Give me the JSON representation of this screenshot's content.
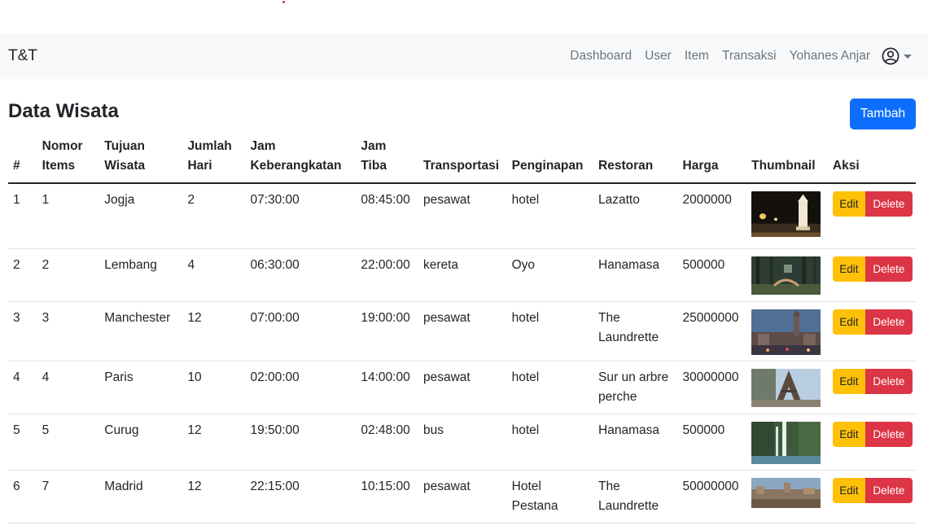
{
  "navbar": {
    "brand": "T&T",
    "links": [
      "Dashboard",
      "User",
      "Item",
      "Transaksi"
    ],
    "user_name": "Yohanes Anjar"
  },
  "page": {
    "title": "Data Wisata",
    "add_button": "Tambah"
  },
  "table": {
    "headers": [
      "#",
      "Nomor Items",
      "Tujuan Wisata",
      "Jumlah Hari",
      "Jam Keberangkatan",
      "Jam Tiba",
      "Transportasi",
      "Penginapan",
      "Restoran",
      "Harga",
      "Thumbnail",
      "Aksi"
    ],
    "edit_label": "Edit",
    "delete_label": "Delete",
    "rows": [
      {
        "no": "1",
        "nomor": "1",
        "tujuan": "Jogja",
        "hari": "2",
        "berangkat": "07:30:00",
        "tiba": "08:45:00",
        "transportasi": "pesawat",
        "penginapan": "hotel",
        "restoran": "Lazatto",
        "harga": "2000000",
        "thumb": "night-monument"
      },
      {
        "no": "2",
        "nomor": "2",
        "tujuan": "Lembang",
        "hari": "4",
        "berangkat": "06:30:00",
        "tiba": "22:00:00",
        "transportasi": "kereta",
        "penginapan": "Oyo",
        "restoran": "Hanamasa",
        "harga": "500000",
        "thumb": "forest-bridge"
      },
      {
        "no": "3",
        "nomor": "3",
        "tujuan": "Manchester",
        "hari": "12",
        "berangkat": "07:00:00",
        "tiba": "19:00:00",
        "transportasi": "pesawat",
        "penginapan": "hotel",
        "restoran": "The Laundrette",
        "harga": "25000000",
        "thumb": "city-clock-tower"
      },
      {
        "no": "4",
        "nomor": "4",
        "tujuan": "Paris",
        "hari": "10",
        "berangkat": "02:00:00",
        "tiba": "14:00:00",
        "transportasi": "pesawat",
        "penginapan": "hotel",
        "restoran": "Sur un arbre perche",
        "harga": "30000000",
        "thumb": "eiffel-tower"
      },
      {
        "no": "5",
        "nomor": "5",
        "tujuan": "Curug",
        "hari": "12",
        "berangkat": "19:50:00",
        "tiba": "02:48:00",
        "transportasi": "bus",
        "penginapan": "hotel",
        "restoran": "Hanamasa",
        "harga": "500000",
        "thumb": "waterfall"
      },
      {
        "no": "6",
        "nomor": "7",
        "tujuan": "Madrid",
        "hari": "12",
        "berangkat": "22:15:00",
        "tiba": "10:15:00",
        "transportasi": "pesawat",
        "penginapan": "Hotel Pestana",
        "restoran": "The Laundrette",
        "harga": "50000000",
        "thumb": "city-skyline"
      }
    ]
  },
  "colors": {
    "primary": "#0d6efd",
    "warning": "#ffc107",
    "danger": "#dc3545",
    "navbar_bg": "#f8f9fa",
    "link_muted": "#6c757d"
  }
}
